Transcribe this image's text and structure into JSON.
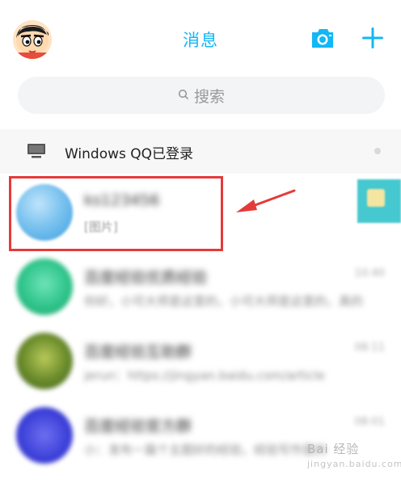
{
  "header": {
    "title": "消息",
    "avatar_icon": "crayon-shin-chan-avatar-icon",
    "camera_icon": "camera-icon",
    "add_icon": "plus-icon",
    "accent_color": "#12b7f5"
  },
  "search": {
    "placeholder": "搜索",
    "icon": "search-icon"
  },
  "login_notice": {
    "text": "Windows QQ已登录",
    "icon": "desktop-computer-icon"
  },
  "conversations": [
    {
      "name": "ks123456",
      "preview": "[图片]",
      "time": ""
    },
    {
      "name": "百度经验优质经验",
      "preview": "你好，小可大师是这里的，小可大师是这里的，真的",
      "time": "10:40"
    },
    {
      "name": "百度经验互助群",
      "preview": "jerun：https://jingyan.baidu.com/article",
      "time": "08:11"
    },
    {
      "name": "百度经验官方群",
      "preview": "小：发布一篇个主题好的经验，经验写作是的",
      "time": "08:01"
    }
  ],
  "annotation": {
    "highlight_color": "#e53a3a"
  },
  "watermark": {
    "text": "Bai 经验",
    "subtext": "jingyan.baidu.com"
  }
}
